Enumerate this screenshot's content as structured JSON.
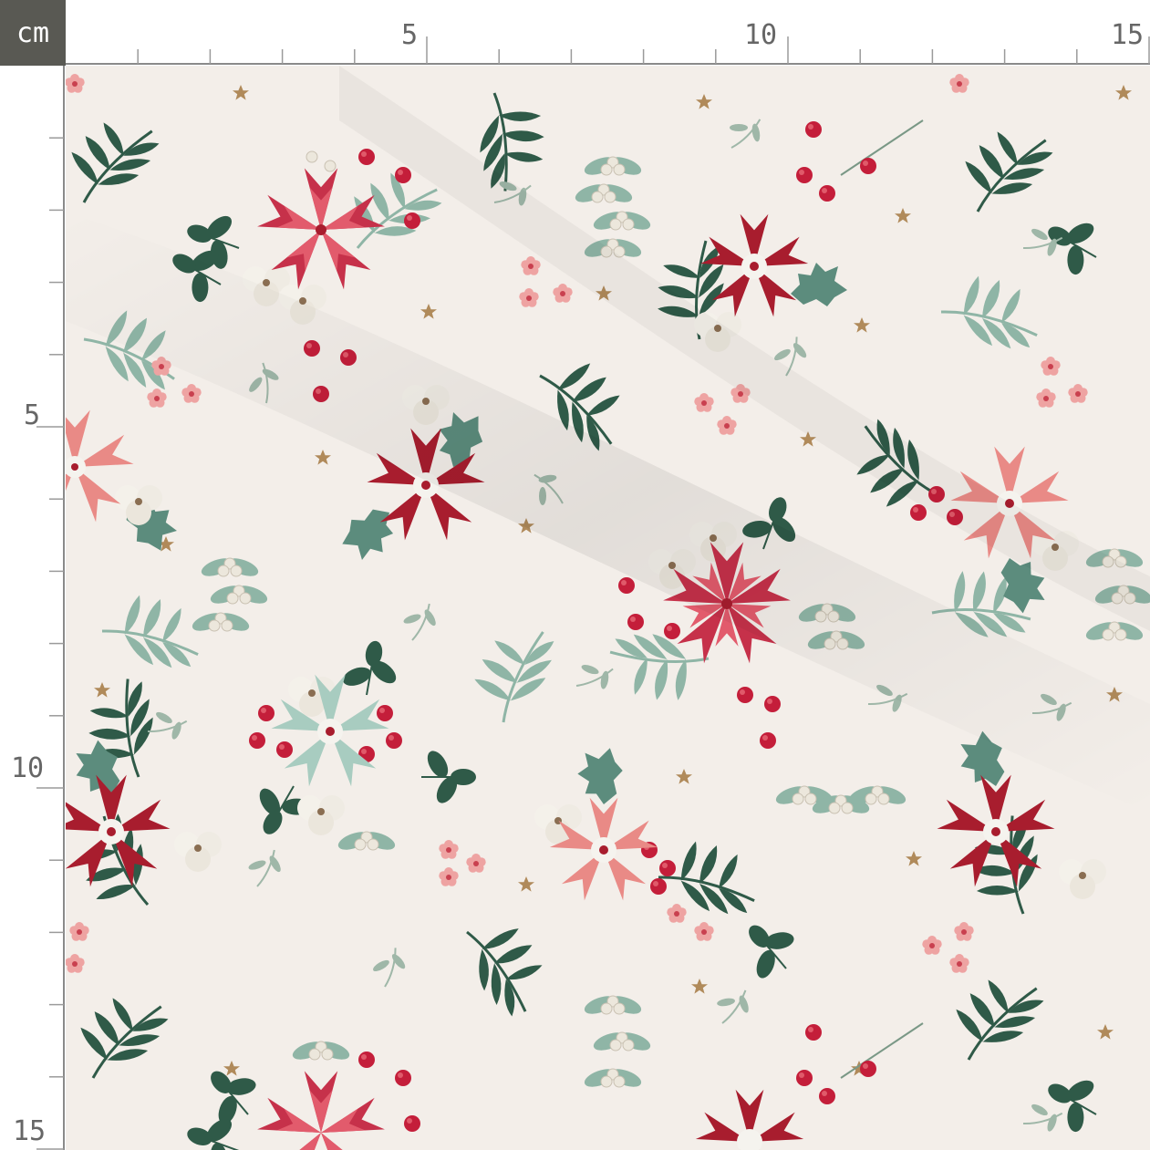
{
  "ruler": {
    "unit_label": "cm",
    "top_marks": [
      "5",
      "10",
      "15"
    ],
    "left_marks": [
      "5",
      "10",
      "15"
    ]
  },
  "fabric": {
    "pattern": "christmas-floral-poinsettia",
    "background_color": "#f3eee9",
    "colors": {
      "dark_green": "#2f5a48",
      "sage_green": "#8fb5a6",
      "deep_red": "#a81d2e",
      "coral_pink": "#e98a86",
      "light_pink": "#f2b7b2",
      "berry_red": "#c41e3a",
      "cotton_white": "#f5f3ee",
      "gold_star": "#b08a5a"
    }
  }
}
